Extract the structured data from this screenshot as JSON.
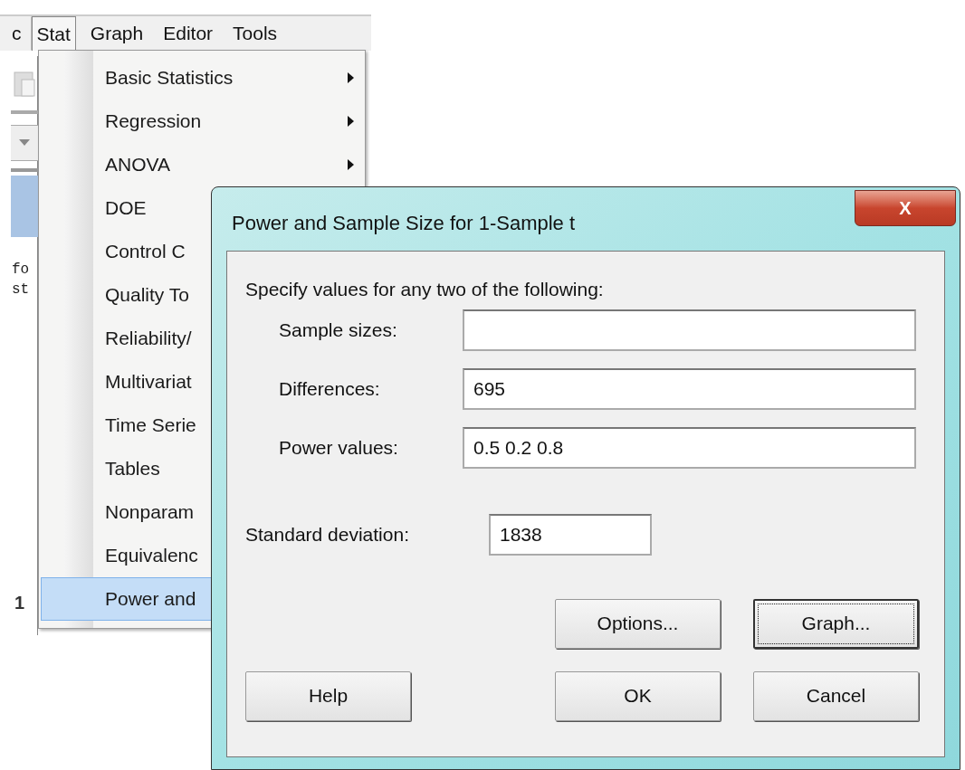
{
  "menu_bar": [
    {
      "label": "c",
      "selected": false
    },
    {
      "label": "Stat",
      "selected": true
    },
    {
      "label": "Graph",
      "selected": false
    },
    {
      "label": "Editor",
      "selected": false
    },
    {
      "label": "Tools",
      "selected": false
    }
  ],
  "background": {
    "session_lines": [
      "fo",
      "st"
    ],
    "worksheet_number": "1"
  },
  "stat_menu": [
    {
      "label": "Basic Statistics",
      "submenu": true,
      "selected": false
    },
    {
      "label": "Regression",
      "submenu": true,
      "selected": false
    },
    {
      "label": "ANOVA",
      "submenu": true,
      "selected": false
    },
    {
      "label": "DOE",
      "selected": false
    },
    {
      "label": "Control C",
      "selected": false
    },
    {
      "label": "Quality To",
      "selected": false
    },
    {
      "label": "Reliability/",
      "selected": false
    },
    {
      "label": "Multivariat",
      "selected": false
    },
    {
      "label": "Time Serie",
      "selected": false
    },
    {
      "label": "Tables",
      "selected": false
    },
    {
      "label": "Nonparam",
      "selected": false
    },
    {
      "label": "Equivalenc",
      "selected": false
    },
    {
      "label": "Power and",
      "selected": true
    }
  ],
  "dialog": {
    "title": "Power and Sample Size for 1-Sample t",
    "close": "X",
    "instruction": "Specify values for any two of the following:",
    "fields": [
      {
        "label": "Sample sizes:"
      },
      {
        "label": "Differences:",
        "value": "695"
      },
      {
        "label": "Power values:",
        "value": "0.5 0.2 0.8"
      }
    ],
    "std_dev": {
      "label": "Standard deviation:",
      "value": "1838"
    },
    "buttons": [
      {
        "label": "Options...",
        "focused": false
      },
      {
        "label": "Graph...",
        "focused": true
      },
      {
        "label": "Help",
        "focused": false
      },
      {
        "label": "OK",
        "focused": false
      },
      {
        "label": "Cancel",
        "focused": false
      }
    ]
  }
}
